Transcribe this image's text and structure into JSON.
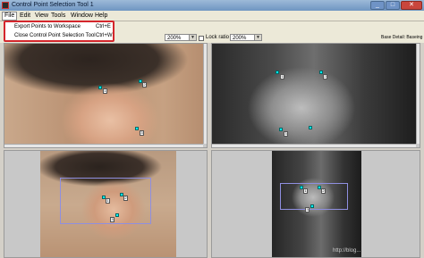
{
  "window": {
    "title": "Control Point Selection Tool 1"
  },
  "titlebar_buttons": {
    "minimize": "_",
    "maximize": "□",
    "close": "✕"
  },
  "menubar": {
    "items": [
      "File",
      "Edit",
      "View",
      "Tools",
      "Window",
      "Help"
    ]
  },
  "file_menu": {
    "items": [
      {
        "label": "Export Points to Workspace",
        "shortcut": "Ctrl+E"
      },
      {
        "label": "Close Control Point Selection Tool",
        "shortcut": "Ctrl+W"
      }
    ]
  },
  "toolbar": {
    "left_zoom": "200%",
    "lock_ratio_label": "Lock ratio",
    "right_zoom": "200%",
    "base_detail_label": "Base Detail: Baseing"
  },
  "control_points": {
    "input_detail": [
      "1",
      "2",
      "3"
    ],
    "base_detail": [
      "1",
      "2",
      "3"
    ],
    "input_overview": [
      "1",
      "2",
      "3"
    ],
    "base_overview": [
      "1",
      "2",
      "3"
    ]
  },
  "watermark": "http://blog..."
}
